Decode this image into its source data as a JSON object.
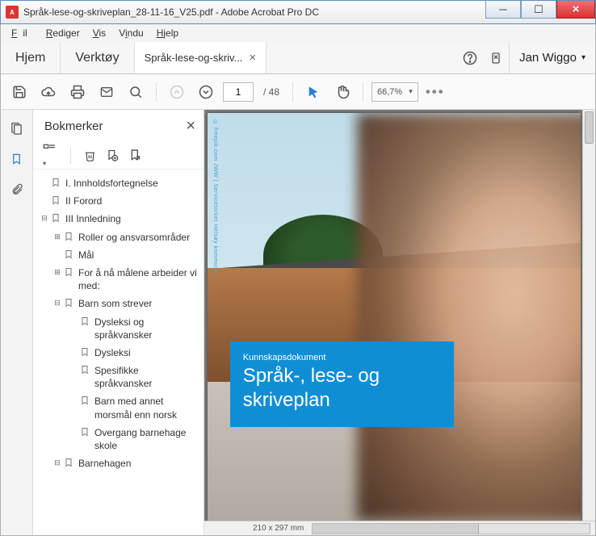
{
  "window": {
    "title": "Språk-lese-og-skriveplan_28-11-16_V25.pdf - Adobe Acrobat Pro DC"
  },
  "menubar": {
    "file": "Fil",
    "edit": "Rediger",
    "view": "Vis",
    "window": "Vindu",
    "help": "Hjelp"
  },
  "header": {
    "home": "Hjem",
    "tools": "Verktøy",
    "tab_label": "Språk-lese-og-skriv...",
    "user": "Jan Wiggo"
  },
  "toolbar": {
    "page_current": "1",
    "page_total": "/ 48",
    "zoom": "66,7%"
  },
  "bookmarks": {
    "title": "Bokmerker",
    "items": [
      {
        "level": 0,
        "tree": "",
        "label": "I. Innholdsfortegnelse"
      },
      {
        "level": 0,
        "tree": "",
        "label": "II  Forord"
      },
      {
        "level": 0,
        "tree": "−",
        "label": "III Innledning"
      },
      {
        "level": 1,
        "tree": "+",
        "label": "Roller og ansvarsområder"
      },
      {
        "level": 1,
        "tree": "",
        "label": "Mål"
      },
      {
        "level": 1,
        "tree": "+",
        "label": "For å nå målene arbeider vi med:"
      },
      {
        "level": 1,
        "tree": "−",
        "label": "Barn som strever"
      },
      {
        "level": 2,
        "tree": "",
        "label": "Dysleksi og språkvansker"
      },
      {
        "level": 2,
        "tree": "",
        "label": "Dysleksi"
      },
      {
        "level": 2,
        "tree": "",
        "label": "Spesifikke språkvansker"
      },
      {
        "level": 2,
        "tree": "",
        "label": "Barn med annet morsmål enn norsk"
      },
      {
        "level": 2,
        "tree": "",
        "label": "Overgang barnehage skole"
      },
      {
        "level": 1,
        "tree": "−",
        "label": "Barnehagen"
      }
    ]
  },
  "document": {
    "side_credit": "© freepik.com   JWW | Servicetorket Helsøy kommune",
    "blue_sub": "Kunnskapsdokument",
    "blue_title": "Språk-, lese- og skriveplan",
    "page_dim": "210 x 297 mm"
  }
}
